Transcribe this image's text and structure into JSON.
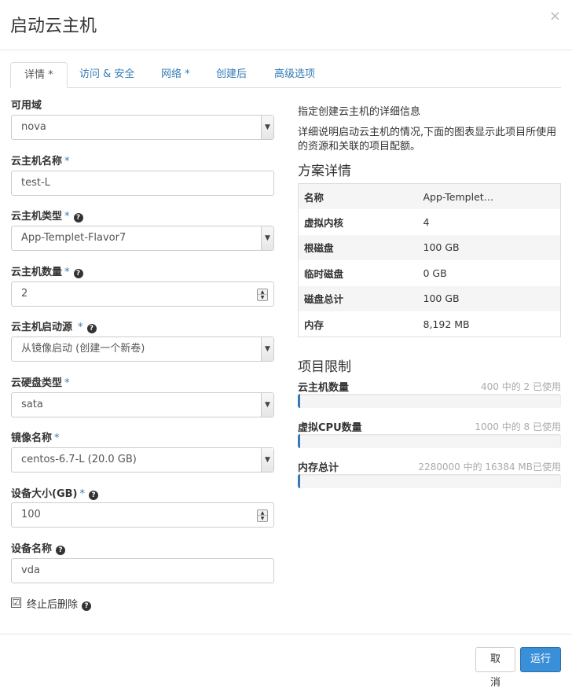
{
  "modal": {
    "title": "启动云主机",
    "close_symbol": "×"
  },
  "tabs": [
    {
      "label": "详情 *"
    },
    {
      "label": "访问 & 安全"
    },
    {
      "label": "网络 *"
    },
    {
      "label": "创建后"
    },
    {
      "label": "高级选项"
    }
  ],
  "form": {
    "availability_zone": {
      "label": "可用域",
      "value": "nova"
    },
    "instance_name": {
      "label": "云主机名称",
      "required": "*",
      "value": "test-L"
    },
    "flavor": {
      "label": "云主机类型",
      "required": "*",
      "value": "App-Templet-Flavor7"
    },
    "count": {
      "label": "云主机数量",
      "required": "*",
      "value": "2"
    },
    "boot_source": {
      "label": "云主机启动源",
      "required": "*",
      "value": "从镜像启动 (创建一个新卷)"
    },
    "volume_type": {
      "label": "云硬盘类型",
      "required": "*",
      "value": "sata"
    },
    "image": {
      "label": "镜像名称",
      "required": "*",
      "value": "centos-6.7-L (20.0 GB)"
    },
    "device_size": {
      "label": "设备大小(GB)",
      "required": "*",
      "value": "100"
    },
    "device_name": {
      "label": "设备名称",
      "value": "vda"
    },
    "delete_on_terminate": {
      "label": "终止后删除",
      "checked": true,
      "check_symbol": "☑"
    },
    "help_symbol": "?"
  },
  "info": {
    "intro": "指定创建云主机的详细信息",
    "description": "详细说明启动云主机的情况,下面的图表显示此项目所使用的资源和关联的项目配额。",
    "flavor_details_title": "方案详情",
    "flavor_details": [
      {
        "key": "名称",
        "value": "App-Templet…"
      },
      {
        "key": "虚拟内核",
        "value": "4"
      },
      {
        "key": "根磁盘",
        "value": "100 GB"
      },
      {
        "key": "临时磁盘",
        "value": "0 GB"
      },
      {
        "key": "磁盘总计",
        "value": "100 GB"
      },
      {
        "key": "内存",
        "value": "8,192 MB"
      }
    ],
    "project_limits_title": "项目限制",
    "quotas": [
      {
        "label": "云主机数量",
        "used_text": "400 中的 2 已使用",
        "used": 2,
        "total": 400
      },
      {
        "label": "虚拟CPU数量",
        "used_text": "1000 中的 8 已使用",
        "used": 8,
        "total": 1000
      },
      {
        "label": "内存总计",
        "used_text": "2280000 中的 16384 MB已使用",
        "used": 16384,
        "total": 2280000
      }
    ]
  },
  "footer": {
    "cancel_label": "取消",
    "launch_label": "运行"
  },
  "colors": {
    "accent": "#337ab7",
    "primary_button": "#3a8fd9"
  }
}
